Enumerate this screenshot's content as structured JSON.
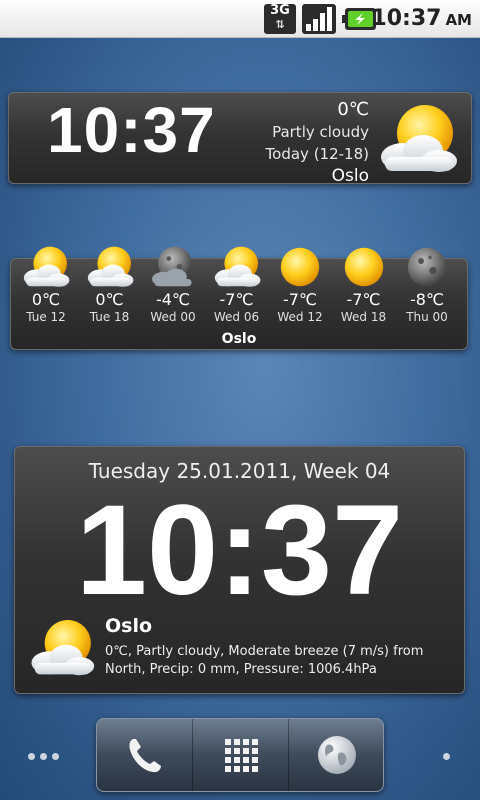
{
  "status_bar": {
    "network": "3G",
    "time": "10:37",
    "ampm": "AM",
    "colors": {
      "battery": "#5fcf2a"
    }
  },
  "widget_top": {
    "time": "10:37",
    "temperature": "0℃",
    "condition": "Partly cloudy",
    "today": "Today  (12-18)",
    "city": "Oslo",
    "icon": "sun-cloud-icon"
  },
  "forecast": {
    "city": "Oslo",
    "items": [
      {
        "temp": "0℃",
        "label": "Tue 12",
        "icon": "sun-cloud-icon"
      },
      {
        "temp": "0℃",
        "label": "Tue 18",
        "icon": "sun-cloud-icon"
      },
      {
        "temp": "-4℃",
        "label": "Wed 00",
        "icon": "moon-cloud-icon"
      },
      {
        "temp": "-7℃",
        "label": "Wed 06",
        "icon": "sun-cloud-icon"
      },
      {
        "temp": "-7℃",
        "label": "Wed 12",
        "icon": "sun-icon"
      },
      {
        "temp": "-7℃",
        "label": "Wed 18",
        "icon": "sun-icon"
      },
      {
        "temp": "-8℃",
        "label": "Thu 00",
        "icon": "moon-icon"
      }
    ]
  },
  "widget_clock": {
    "date": "Tuesday 25.01.2011, Week 04",
    "time": "10:37",
    "city": "Oslo",
    "description": "0℃, Partly cloudy, Moderate breeze (7 m/s) from North, Precip: 0 mm, Pressure: 1006.4hPa",
    "icon": "sun-cloud-icon"
  },
  "dock": {
    "buttons": [
      "phone-icon",
      "app-grid-icon",
      "browser-globe-icon"
    ]
  }
}
